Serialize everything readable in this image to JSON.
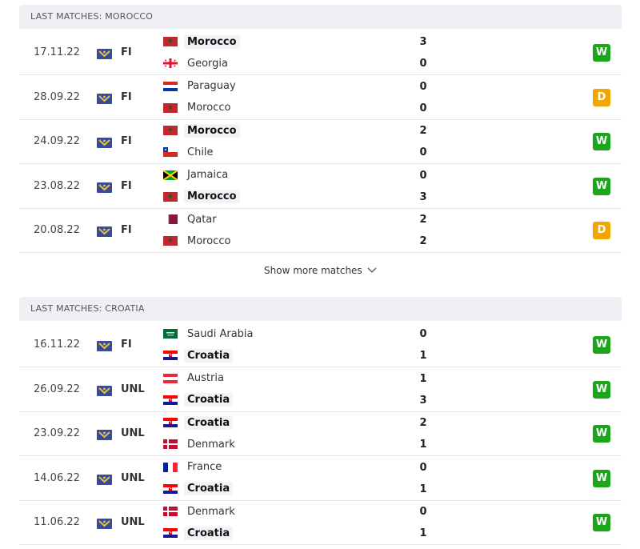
{
  "colors": {
    "win": "#1aa51a",
    "draw": "#f2a600",
    "header_bg": "#eef0f3"
  },
  "show_more_label": "Show more matches",
  "sections": [
    {
      "title": "LAST MATCHES: MOROCCO",
      "matches": [
        {
          "date": "17.11.22",
          "comp": "FI",
          "home": {
            "name": "Morocco",
            "flag": "morocco",
            "bold": true
          },
          "away": {
            "name": "Georgia",
            "flag": "georgia",
            "bold": false
          },
          "home_score": "3",
          "away_score": "0",
          "result": "W"
        },
        {
          "date": "28.09.22",
          "comp": "FI",
          "home": {
            "name": "Paraguay",
            "flag": "paraguay",
            "bold": false
          },
          "away": {
            "name": "Morocco",
            "flag": "morocco",
            "bold": false
          },
          "home_score": "0",
          "away_score": "0",
          "result": "D"
        },
        {
          "date": "24.09.22",
          "comp": "FI",
          "home": {
            "name": "Morocco",
            "flag": "morocco",
            "bold": true
          },
          "away": {
            "name": "Chile",
            "flag": "chile",
            "bold": false
          },
          "home_score": "2",
          "away_score": "0",
          "result": "W"
        },
        {
          "date": "23.08.22",
          "comp": "FI",
          "home": {
            "name": "Jamaica",
            "flag": "jamaica",
            "bold": false
          },
          "away": {
            "name": "Morocco",
            "flag": "morocco",
            "bold": true
          },
          "home_score": "0",
          "away_score": "3",
          "result": "W"
        },
        {
          "date": "20.08.22",
          "comp": "FI",
          "home": {
            "name": "Qatar",
            "flag": "qatar",
            "bold": false
          },
          "away": {
            "name": "Morocco",
            "flag": "morocco",
            "bold": false
          },
          "home_score": "2",
          "away_score": "2",
          "result": "D"
        }
      ]
    },
    {
      "title": "LAST MATCHES: CROATIA",
      "matches": [
        {
          "date": "16.11.22",
          "comp": "FI",
          "home": {
            "name": "Saudi Arabia",
            "flag": "saudi",
            "bold": false
          },
          "away": {
            "name": "Croatia",
            "flag": "croatia",
            "bold": true
          },
          "home_score": "0",
          "away_score": "1",
          "result": "W"
        },
        {
          "date": "26.09.22",
          "comp": "UNL",
          "home": {
            "name": "Austria",
            "flag": "austria",
            "bold": false
          },
          "away": {
            "name": "Croatia",
            "flag": "croatia",
            "bold": true
          },
          "home_score": "1",
          "away_score": "3",
          "result": "W"
        },
        {
          "date": "23.09.22",
          "comp": "UNL",
          "home": {
            "name": "Croatia",
            "flag": "croatia",
            "bold": true
          },
          "away": {
            "name": "Denmark",
            "flag": "denmark",
            "bold": false
          },
          "home_score": "2",
          "away_score": "1",
          "result": "W"
        },
        {
          "date": "14.06.22",
          "comp": "UNL",
          "home": {
            "name": "France",
            "flag": "france",
            "bold": false
          },
          "away": {
            "name": "Croatia",
            "flag": "croatia",
            "bold": true
          },
          "home_score": "0",
          "away_score": "1",
          "result": "W"
        },
        {
          "date": "11.06.22",
          "comp": "UNL",
          "home": {
            "name": "Denmark",
            "flag": "denmark",
            "bold": false
          },
          "away": {
            "name": "Croatia",
            "flag": "croatia",
            "bold": true
          },
          "home_score": "0",
          "away_score": "1",
          "result": "W"
        }
      ]
    }
  ]
}
